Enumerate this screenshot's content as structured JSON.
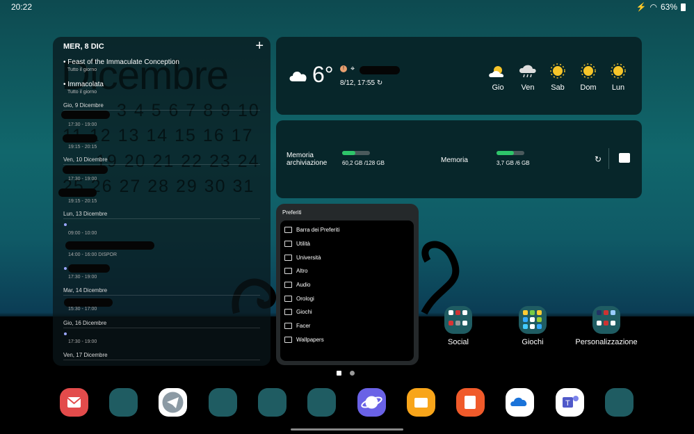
{
  "status": {
    "time": "20:22",
    "battery": "63%"
  },
  "calendar": {
    "header": "MER, 8 DIC",
    "bg_title": "Dicembre",
    "bg_rows": [
      "3 4 5 6 7 8 9 10",
      "11 12 13 14 15 16 17",
      "19 20 21 22 23 24",
      "25 26 27 28 29 30 31"
    ],
    "events": [
      {
        "title": "Feast of the Immaculate Conception",
        "sub": "Tutto il giorno"
      },
      {
        "title": "Immacolata",
        "sub": "Tutto il giorno"
      }
    ],
    "days": [
      {
        "label": "Gio, 9 Dicembre",
        "times": [
          "17:30 - 19:00",
          "19:15 - 20:15"
        ]
      },
      {
        "label": "Ven, 10 Dicembre",
        "times": [
          "17:30 - 19:00",
          "19:15 - 20:15"
        ]
      },
      {
        "label": "Lun, 13 Dicembre",
        "times": [
          "09:00 - 10:00",
          "14:00 - 16:00 DISPOR",
          "17:30 - 19:00"
        ]
      },
      {
        "label": "Mar, 14 Dicembre",
        "times": [
          "15:30 - 17:00"
        ]
      },
      {
        "label": "Gio, 16 Dicembre",
        "times": [
          "17:30 - 19:00"
        ]
      },
      {
        "label": "Ven, 17 Dicembre",
        "times": []
      }
    ]
  },
  "weather": {
    "temp": "6°",
    "date": "8/12, 17:55",
    "forecast": [
      {
        "day": "Gio",
        "icon": "partly-sunny-icon"
      },
      {
        "day": "Ven",
        "icon": "rain-cloud-icon"
      },
      {
        "day": "Sab",
        "icon": "sun-icon"
      },
      {
        "day": "Dom",
        "icon": "sun-icon"
      },
      {
        "day": "Lun",
        "icon": "sun-icon"
      }
    ]
  },
  "memory": {
    "storage_label_1": "Memoria",
    "storage_label_2": "archiviazione",
    "storage_value": "60,2 GB /128 GB",
    "storage_fraction": 0.47,
    "ram_label": "Memoria",
    "ram_value": "3,7 GB /6 GB",
    "ram_fraction": 0.62
  },
  "favourites": {
    "title": "Preferiti",
    "items": [
      "Barra dei Preferiti",
      "Utilità",
      "Università",
      "Altro",
      "Audio",
      "Orologi",
      "Giochi",
      "Facer",
      "Wallpapers"
    ]
  },
  "home_folders": [
    {
      "label": "Social"
    },
    {
      "label": "Giochi"
    },
    {
      "label": "Personalizzazione"
    }
  ],
  "dock": [
    "Gmail",
    "Folder",
    "Telegram",
    "Folder",
    "Folder",
    "Folder",
    "Samsung Internet",
    "My Files",
    "Samsung Notes",
    "OneDrive",
    "Teams",
    "Folder"
  ],
  "colors": {
    "accent_green": "#2ec56a",
    "widget_bg": "#07262a"
  }
}
